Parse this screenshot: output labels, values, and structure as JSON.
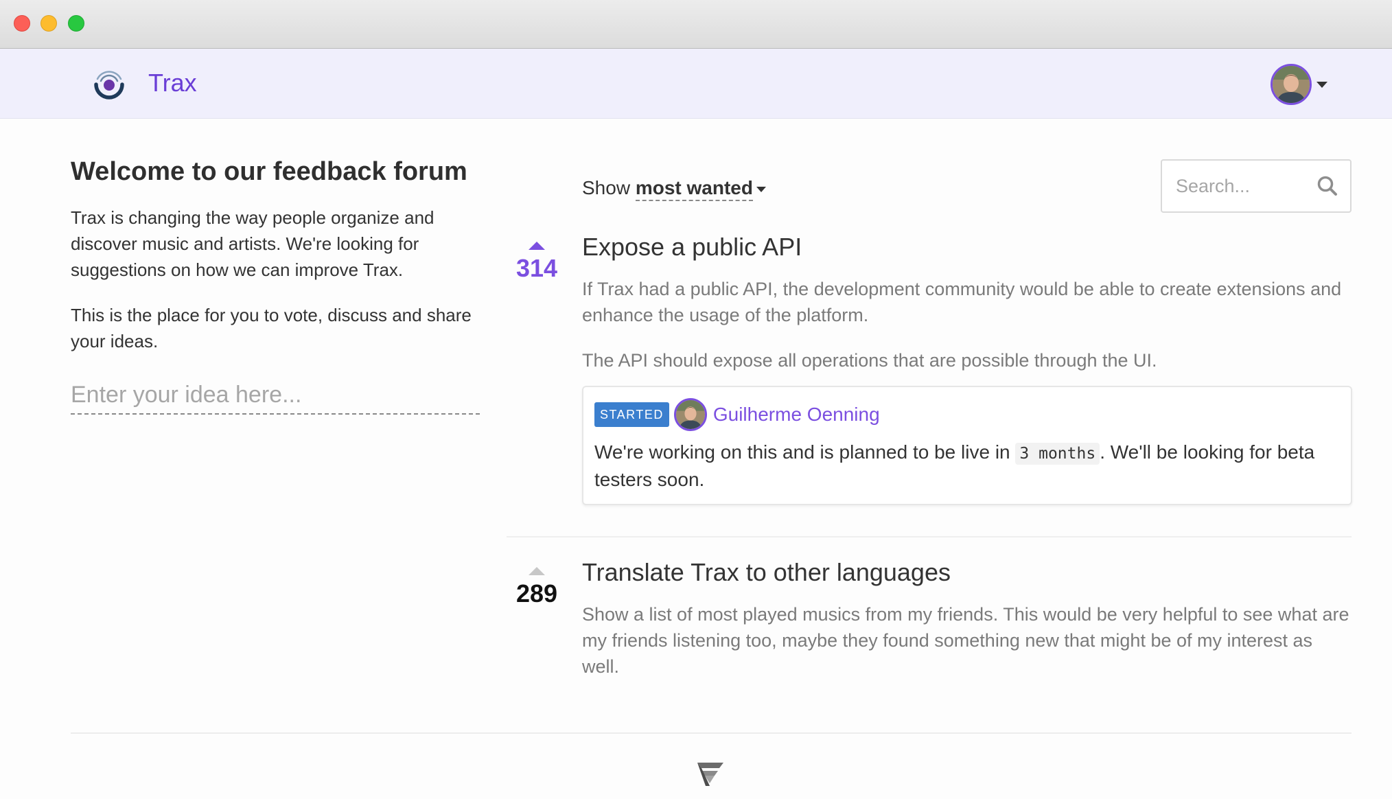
{
  "app": {
    "brand": "Trax",
    "accent_color": "#7b4fe0",
    "header_bg": "#f0effc"
  },
  "window": {
    "controls": [
      "close-icon",
      "minimize-icon",
      "maximize-icon"
    ]
  },
  "header": {
    "logo_icon": "trax-logo-icon",
    "user_avatar": "user-avatar",
    "menu_icon": "caret-down-icon"
  },
  "sidebar": {
    "title": "Welcome to our feedback forum",
    "intro": "Trax is changing the way people organize and discover music and artists. We're looking for suggestions on how we can improve Trax.",
    "cta": "This is the place for you to vote, discuss and share your ideas.",
    "idea_placeholder": "Enter your idea here..."
  },
  "toolbar": {
    "show_label": "Show",
    "sort_value": "most wanted",
    "search_placeholder": "Search...",
    "search_icon": "search-icon"
  },
  "ideas": [
    {
      "votes": "314",
      "voted": true,
      "title": "Expose a public API",
      "description": [
        "If Trax had a public API, the development community would be able to create extensions and enhance the usage of the platform.",
        "The API should expose all operations that are possible through the UI."
      ],
      "status": {
        "badge": "STARTED",
        "badge_color": "#3b7fce",
        "author": "Guilherme Oenning",
        "text_before": "We're working on this and is planned to be live in ",
        "code": "3 months",
        "text_after": ". We'll be looking for beta testers soon."
      }
    },
    {
      "votes": "289",
      "voted": false,
      "title": "Translate Trax to other languages",
      "description": [
        "Show a list of most played musics from my friends. This would be very helpful to see what are my friends listening too, maybe they found something new that might be of my interest as well."
      ]
    }
  ],
  "footer": {
    "logo_icon": "fider-logo-icon"
  }
}
